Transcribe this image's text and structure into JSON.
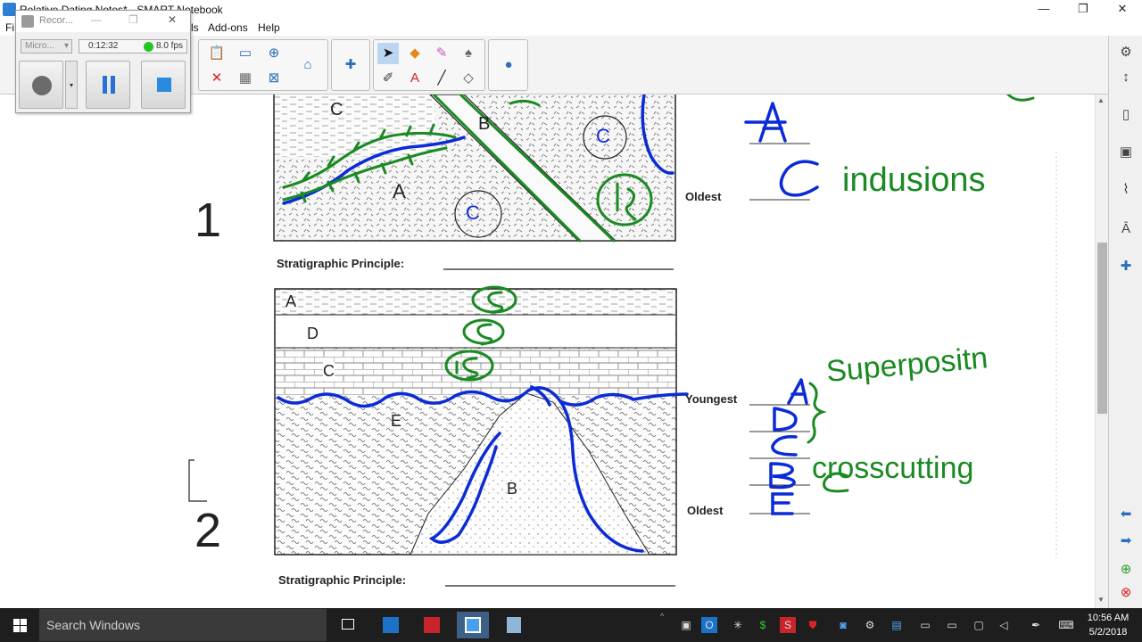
{
  "window": {
    "title": "Relative Dating Notes* - SMART Notebook",
    "min": "—",
    "restore": "❐",
    "close": "✕"
  },
  "menu": {
    "file": "Fi",
    "tools_suffix": "ls",
    "addons": "Add-ons",
    "help": "Help"
  },
  "recorder": {
    "title": "Recor...",
    "device": "Micro...",
    "elapsed": "0:12:32",
    "fps": "8.0 fps",
    "status_color": "#22c522"
  },
  "worksheet": {
    "q1_number": "1",
    "q2_number": "2",
    "principle_label": "Stratigraphic Principle:",
    "youngest": "Youngest",
    "oldest": "Oldest",
    "d1_layers": {
      "a": "A",
      "b": "B",
      "c1": "C",
      "c2": "C",
      "c3": "C"
    },
    "d2_layers": {
      "a": "A",
      "d": "D",
      "c": "C",
      "e": "E",
      "b": "B"
    }
  },
  "annotations": {
    "q1_answer_a": "A",
    "q1_answer_c": "C",
    "q1_word": "indusions",
    "q2_sequence": [
      "A",
      "D",
      "C",
      "B",
      "E"
    ],
    "q2_word_1": "Superpositn",
    "q2_word_2": "crosscutting",
    "ink_blue": "#0a2bd6",
    "ink_green": "#1a8a22"
  },
  "taskbar": {
    "search": "Search Windows",
    "time": "10:56 AM",
    "date": "5/2/2018"
  }
}
